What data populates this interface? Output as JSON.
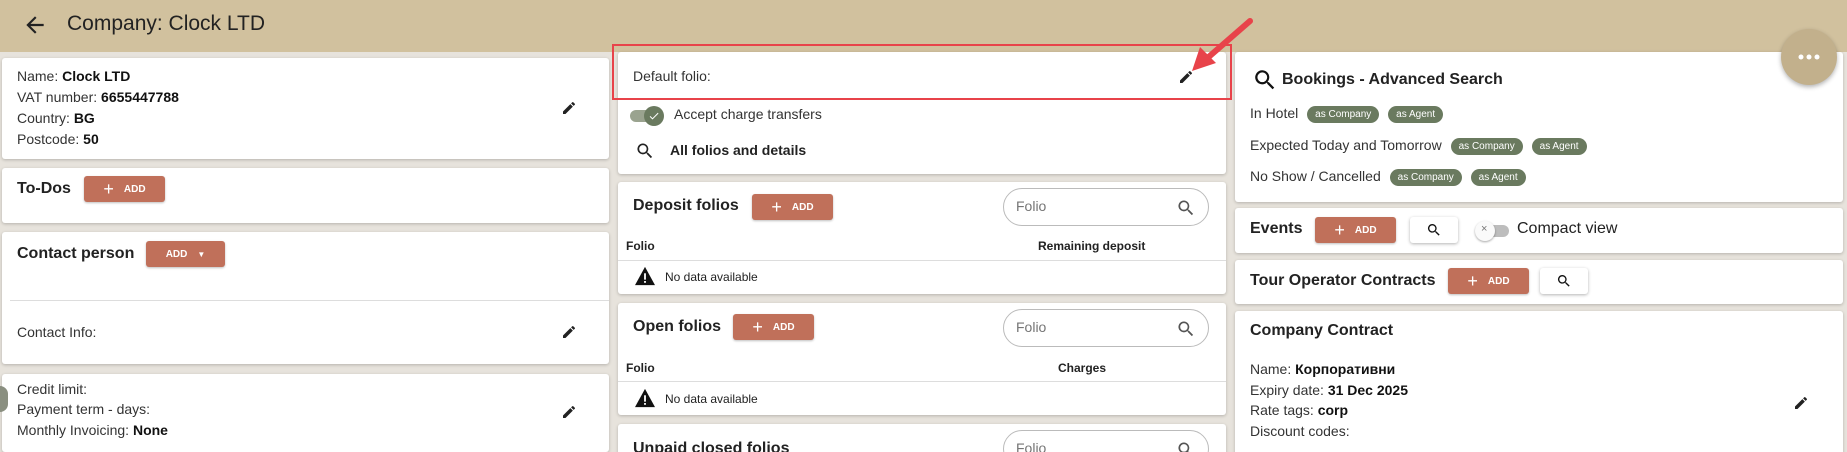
{
  "header": {
    "title": "Company: Clock LTD"
  },
  "company": {
    "name_label": "Name:",
    "name": "Clock LTD",
    "vat_label": "VAT number:",
    "vat": "6655447788",
    "country_label": "Country:",
    "country": "BG",
    "postcode_label": "Postcode:",
    "postcode": "50"
  },
  "todos": {
    "title": "To-Dos",
    "add_label": "ADD"
  },
  "contact_person": {
    "title": "Contact person",
    "add_label": "ADD",
    "info_label": "Contact Info:"
  },
  "credit": {
    "limit_label": "Credit limit:",
    "payment_term_label": "Payment term - days:",
    "monthly_label": "Monthly Invoicing:",
    "monthly_value": "None"
  },
  "folio": {
    "default_label": "Default folio:",
    "accept_transfers_label": "Accept charge transfers",
    "accept_transfers_on": true,
    "all_folios_label": "All folios and details"
  },
  "deposit_folios": {
    "title": "Deposit folios",
    "add_label": "ADD",
    "search_placeholder": "Folio",
    "columns": [
      "Folio",
      "Remaining deposit"
    ],
    "empty_text": "No data available"
  },
  "open_folios": {
    "title": "Open folios",
    "add_label": "ADD",
    "search_placeholder": "Folio",
    "columns": [
      "Folio",
      "Charges"
    ],
    "empty_text": "No data available"
  },
  "unpaid_folios": {
    "title": "Unpaid closed folios",
    "search_placeholder": "Folio"
  },
  "bookings": {
    "title": "Bookings - Advanced Search",
    "rows": [
      {
        "label": "In Hotel",
        "chips": [
          "as Company",
          "as Agent"
        ]
      },
      {
        "label": "Expected Today and Tomorrow",
        "chips": [
          "as Company",
          "as Agent"
        ]
      },
      {
        "label": "No Show / Cancelled",
        "chips": [
          "as Company",
          "as Agent"
        ]
      }
    ]
  },
  "events": {
    "title": "Events",
    "add_label": "ADD",
    "compact_view_label": "Compact view",
    "compact_view_on": false
  },
  "tour_operator": {
    "title": "Tour Operator Contracts",
    "add_label": "ADD"
  },
  "company_contract": {
    "title": "Company Contract",
    "name_label": "Name:",
    "name": "Корпоративни",
    "expiry_label": "Expiry date:",
    "expiry": "31 Dec 2025",
    "rate_tags_label": "Rate tags:",
    "rate_tags": "corp",
    "discount_label": "Discount codes:"
  },
  "colors": {
    "header_bg": "#d1c19e",
    "accent": "#c0705a",
    "chip": "#6a7a5f",
    "highlight": "#e8434a"
  }
}
